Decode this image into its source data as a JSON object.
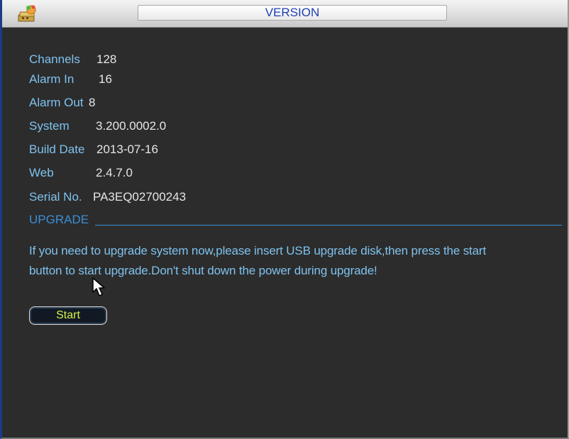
{
  "window": {
    "title": "VERSION"
  },
  "info": [
    {
      "label": "Channels",
      "value": "128"
    },
    {
      "label": "Alarm In",
      "value": "16"
    },
    {
      "label": "Alarm Out",
      "value": "8"
    },
    {
      "label": "System",
      "value": "3.200.0002.0"
    },
    {
      "label": "Build Date",
      "value": "2013-07-16"
    },
    {
      "label": "Web",
      "value": "2.4.7.0"
    },
    {
      "label": "Serial No.",
      "value": "PA3EQ02700243"
    }
  ],
  "upgrade": {
    "section_label": "UPGRADE",
    "message_line1": "If you need to upgrade system now,please insert USB upgrade disk,then press the start",
    "message_line2": "button to start upgrade.Don't shut down the power during upgrade!",
    "start_label": "Start"
  },
  "colors": {
    "label": "#7fc2ee",
    "value": "#e6e6e6",
    "section": "#3a8fd6",
    "title": "#1f3fb2",
    "button_text": "#d9f24a",
    "background": "#2c2c2c"
  },
  "icons": {
    "title_icon": "app-logo-icon",
    "cursor": "mouse-pointer-icon"
  }
}
